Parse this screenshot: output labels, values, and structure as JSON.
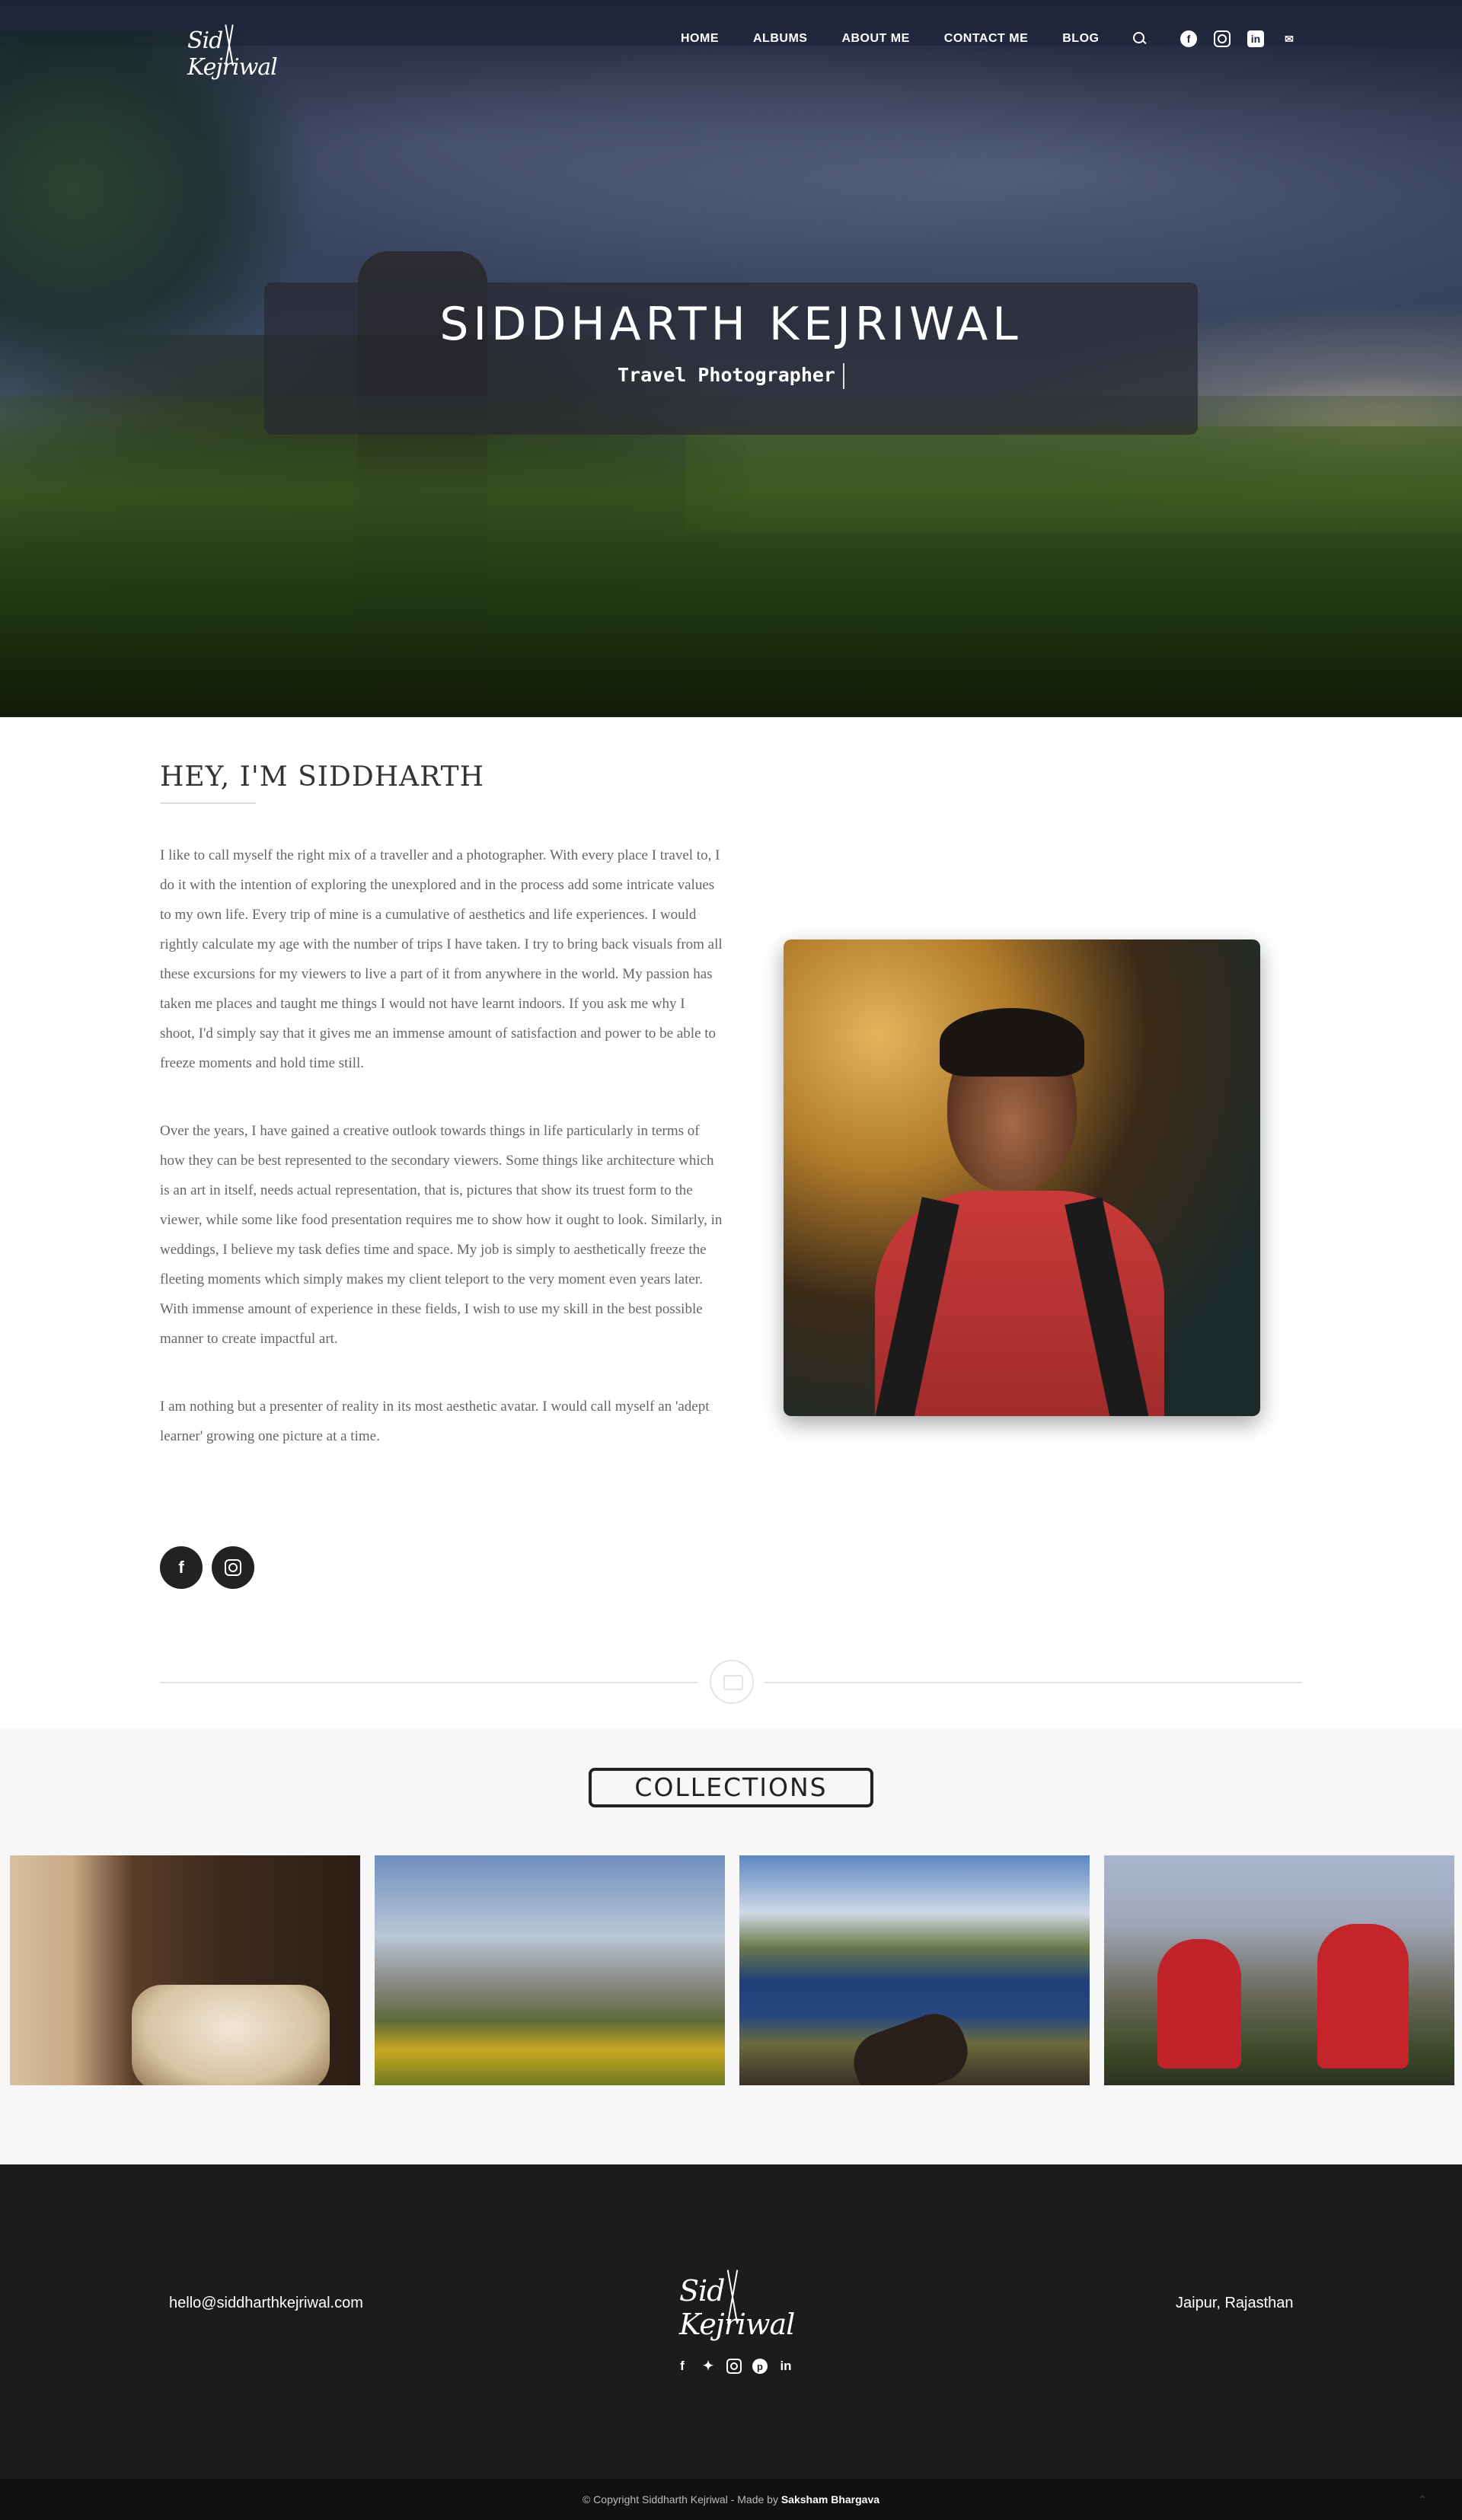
{
  "brand": {
    "logo_text": "Sid Kejriwal"
  },
  "nav": {
    "items": [
      {
        "label": "HOME"
      },
      {
        "label": "ALBUMS"
      },
      {
        "label": "ABOUT ME"
      },
      {
        "label": "CONTACT ME"
      },
      {
        "label": "BLOG"
      }
    ],
    "icons": [
      "search-icon",
      "facebook-icon",
      "instagram-icon",
      "linkedin-icon",
      "envelope-icon"
    ]
  },
  "hero": {
    "name": "SIDDHARTH KEJRIWAL",
    "role": "Travel Photographer"
  },
  "about": {
    "title": "HEY, I'M SIDDHARTH",
    "paragraphs": [
      "I like to call myself the right mix of a traveller and a photographer. With every place I travel to, I do it with the intention of exploring the unexplored and in the process add some intricate values to my own life. Every trip of mine is a cumulative of aesthetics and life experiences. I would rightly calculate my age with the number of trips I have taken. I try to bring back visuals from all these excursions for my viewers to live a part of it from anywhere in the world. My passion has taken me places and taught me things I would not have learnt indoors. If you ask me why I shoot, I'd simply say that it gives me an immense amount of satisfaction and power to be able to freeze moments and hold time still.",
      "Over the years, I have gained a creative outlook towards things in life particularly in terms of how they can be best represented to the secondary viewers. Some things like architecture which is an art in itself, needs actual representation, that is, pictures that show its truest form to the viewer, while some like food presentation requires me to show how it ought to look. Similarly, in weddings, I believe my task defies time and space. My job is simply to aesthetically freeze the fleeting moments which simply makes my client teleport to the very moment even years later. With immense amount of experience in these fields, I wish to use my skill in the best possible manner to create impactful art.",
      "I am nothing but a presenter of reality in its most aesthetic avatar. I would call myself an 'adept learner' growing one picture at a time."
    ],
    "social": [
      "facebook-icon",
      "instagram-icon"
    ]
  },
  "collections": {
    "title": "COLLECTIONS",
    "items": [
      "bedroom",
      "alps",
      "lake",
      "friends"
    ]
  },
  "footer": {
    "email": "hello@siddharthkejriwal.com",
    "location": "Jaipur, Rajasthan",
    "social": [
      "facebook-icon",
      "twitter-icon",
      "instagram-icon",
      "pinterest-icon",
      "linkedin-icon"
    ],
    "copyright_prefix": "© Copyright Siddharth Kejriwal - Made by ",
    "copyright_author": "Saksham Bhargava"
  },
  "colors": {
    "footer_bg": "#1c1c1c",
    "copyright_bg": "#111111",
    "collections_bg": "#f7f7f7",
    "text_dark": "#333333",
    "text_body": "#666666"
  }
}
